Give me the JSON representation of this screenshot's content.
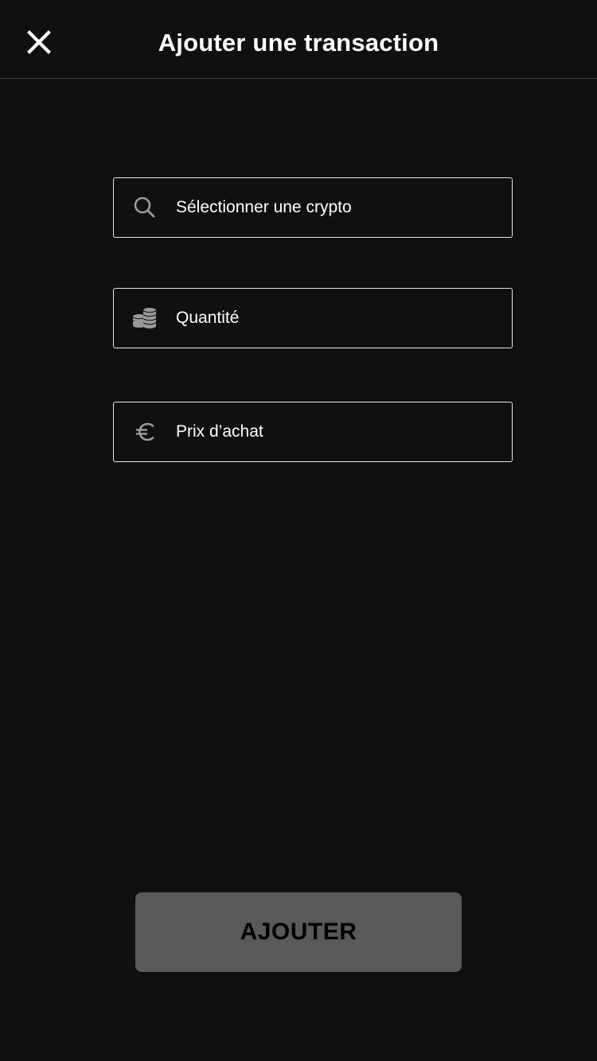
{
  "header": {
    "title": "Ajouter une transaction",
    "close_icon": "close-icon"
  },
  "form": {
    "crypto_field": {
      "icon": "search-icon",
      "placeholder": "Sélectionner une crypto"
    },
    "quantity_field": {
      "icon": "coins-icon",
      "placeholder": "Quantité"
    },
    "price_field": {
      "icon": "euro-icon",
      "placeholder": "Prix d’achat"
    }
  },
  "footer": {
    "submit_label": "AJOUTER"
  },
  "colors": {
    "background": "#101010",
    "text": "#ffffff",
    "field_border": "#e8e8e8",
    "icon_gray": "#9a9a9a",
    "button_disabled": "#595959",
    "button_text": "#000000"
  }
}
